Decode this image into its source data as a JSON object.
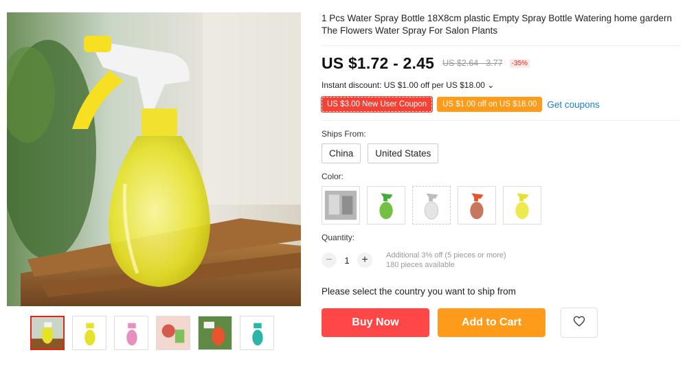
{
  "product": {
    "title": "1 Pcs Water Spray Bottle 18X8cm plastic Empty Spray Bottle Watering home gardern The Flowers Water Spray For Salon Plants",
    "price": "US $1.72 - 2.45",
    "original_price": "US $2.64 - 3.77",
    "discount_pct": "-35%",
    "instant_discount": "Instant discount: US $1.00 off per US $18.00 ⌄"
  },
  "coupons": {
    "new_user": "US $3.00 New User Coupon",
    "off": "US $1.00 off on US $18.00",
    "get_link": "Get coupons"
  },
  "ships_from": {
    "label": "Ships From:",
    "options": [
      "China",
      "United States"
    ]
  },
  "color": {
    "label": "Color:",
    "swatches": [
      "gray",
      "green",
      "white",
      "red",
      "yellow"
    ]
  },
  "quantity": {
    "label": "Quantity:",
    "minus": "−",
    "value": "1",
    "plus": "+",
    "note_line1": "Additional 3% off (5 pieces or more)",
    "note_line2": "180 pieces available"
  },
  "ship_message": "Please select the country you want to ship from",
  "actions": {
    "buy_now": "Buy Now",
    "add_to_cart": "Add to Cart",
    "wishlist_icon": "heart-icon"
  },
  "gallery": {
    "thumbnail_colors": [
      "yellow",
      "yellow",
      "pink",
      "mixed",
      "red",
      "teal"
    ],
    "active_index": 0
  },
  "colors": {
    "accent_red": "#ff4747",
    "accent_orange": "#ff9b1b",
    "link_blue": "#1a83c5"
  }
}
